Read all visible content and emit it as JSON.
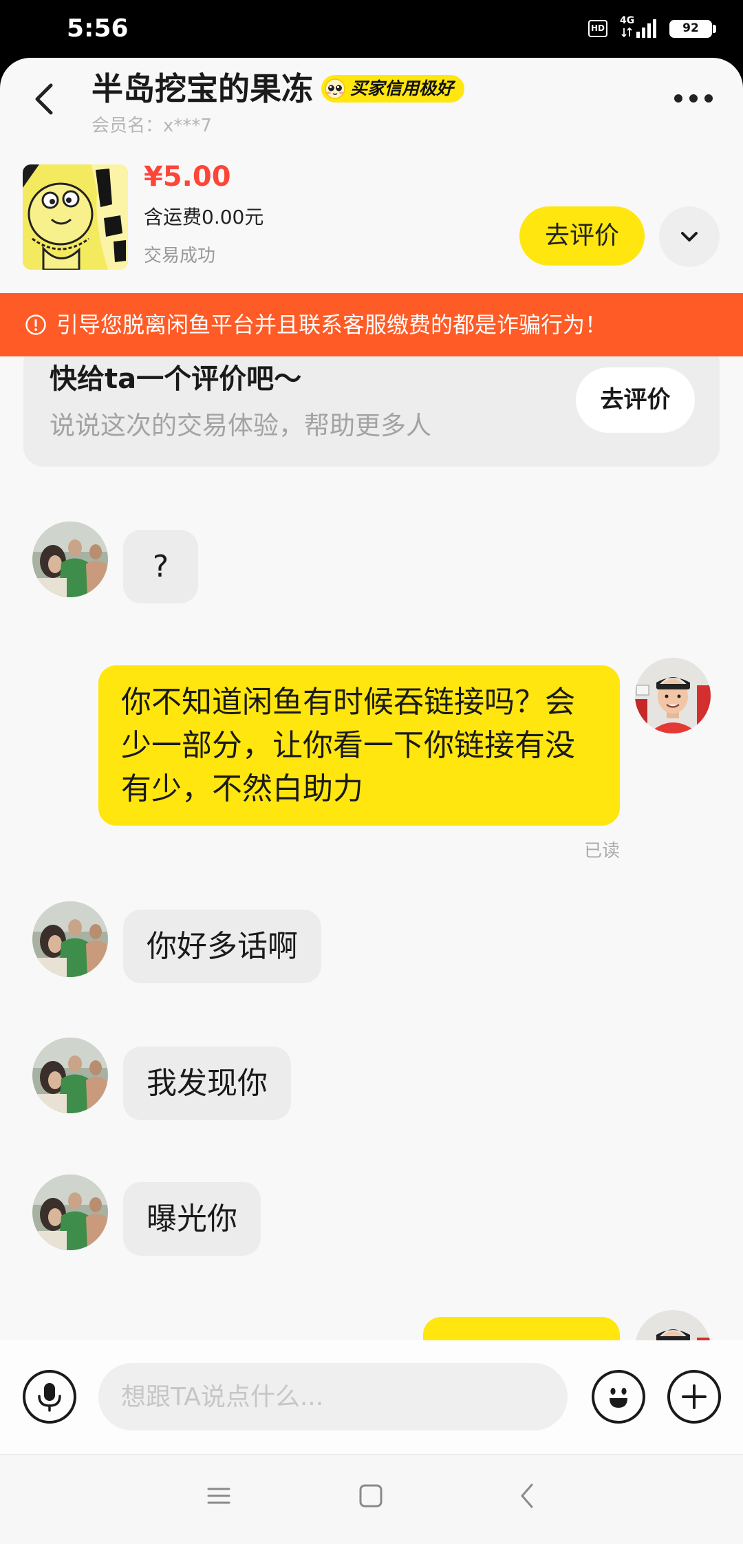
{
  "status_bar": {
    "time": "5:56",
    "hd_label": "HD",
    "network_label": "4G",
    "battery_level": "92"
  },
  "header": {
    "title": "半岛挖宝的果冻",
    "credit_badge": "买家信用极好",
    "member_name": "会员名：x***7"
  },
  "product": {
    "price": "¥5.00",
    "shipping_note": "含运费0.00元",
    "trade_status": "交易成功",
    "review_button_label": "去评价"
  },
  "warning_banner": {
    "text": "引导您脱离闲鱼平台并且联系客服缴费的都是诈骗行为！"
  },
  "review_prompt": {
    "title": "快给ta一个评价吧～",
    "subtitle": "说说这次的交易体验，帮助更多人",
    "button_label": "去评价"
  },
  "messages": [
    {
      "outgoing": false,
      "text": "?"
    },
    {
      "outgoing": true,
      "text": "你不知道闲鱼有时候吞链接吗？会\n少一部分，让你看一下你链接有没\n有少，不然白助力",
      "receipt": "已读"
    },
    {
      "outgoing": false,
      "text": "你好多话啊"
    },
    {
      "outgoing": false,
      "text": "我发现你"
    },
    {
      "outgoing": false,
      "text": "曝光你"
    }
  ],
  "composer": {
    "placeholder": "想跟TA说点什么..."
  },
  "icons": {
    "back": "chevron-left-icon",
    "more": "more-dots-icon",
    "expand": "chevron-down-icon",
    "warning": "info-icon",
    "voice": "mic-icon",
    "emoji": "smiley-icon",
    "attach": "plus-icon",
    "nav": [
      "menu-icon",
      "home-square-icon",
      "nav-back-icon"
    ]
  },
  "colors": {
    "accent_yellow": "#ffe60f",
    "price_red": "#ff4438",
    "warning_orange": "#ff5b26",
    "incoming_bubble": "#ececec"
  }
}
